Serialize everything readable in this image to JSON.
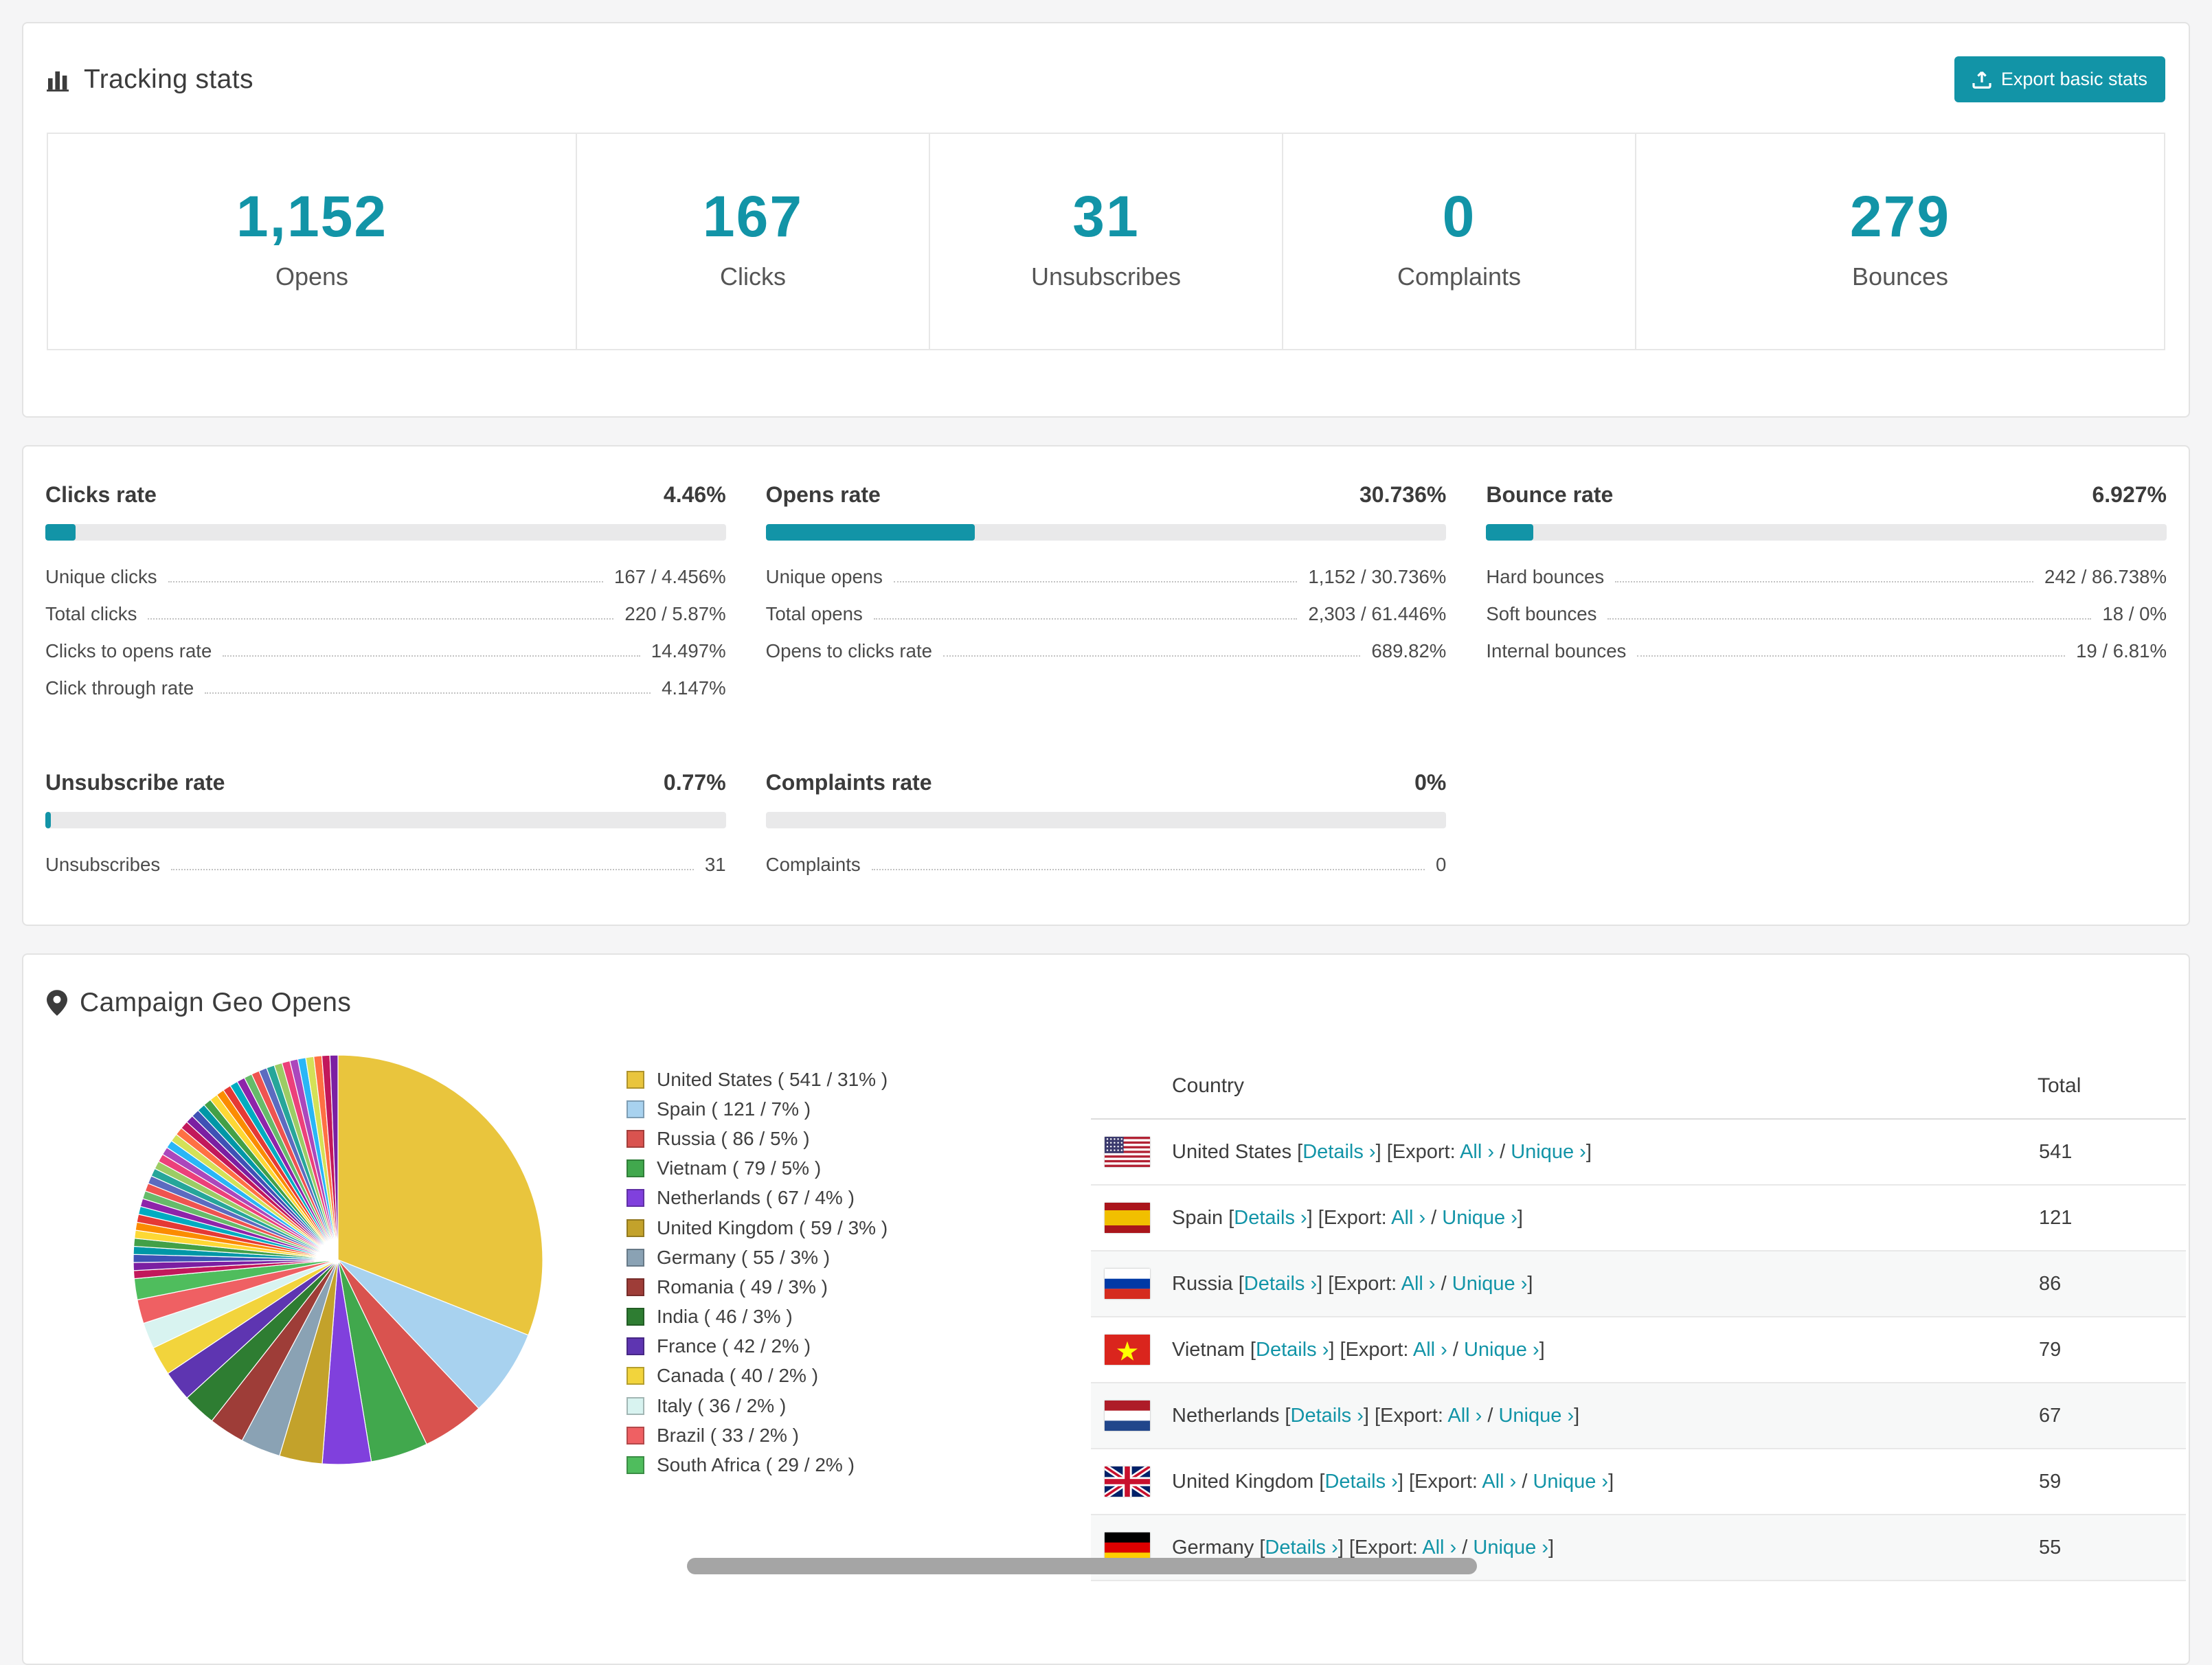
{
  "colors": {
    "accent": "#1294a7",
    "page_background": "#f5f5f6",
    "bar_track": "#e9e9ea"
  },
  "tracking": {
    "title": "Tracking stats",
    "export_button": "Export basic stats",
    "stats": [
      {
        "value": "1,152",
        "label": "Opens"
      },
      {
        "value": "167",
        "label": "Clicks"
      },
      {
        "value": "31",
        "label": "Unsubscribes"
      },
      {
        "value": "0",
        "label": "Complaints"
      },
      {
        "value": "279",
        "label": "Bounces"
      }
    ]
  },
  "rates": [
    {
      "title": "Clicks rate",
      "value": "4.46%",
      "percent_value": 4.46,
      "rows": [
        {
          "label": "Unique clicks",
          "value": "167 / 4.456%"
        },
        {
          "label": "Total clicks",
          "value": "220 / 5.87%"
        },
        {
          "label": "Clicks to opens rate",
          "value": "14.497%"
        },
        {
          "label": "Click through rate",
          "value": "4.147%"
        }
      ]
    },
    {
      "title": "Opens rate",
      "value": "30.736%",
      "percent_value": 30.736,
      "rows": [
        {
          "label": "Unique opens",
          "value": "1,152 / 30.736%"
        },
        {
          "label": "Total opens",
          "value": "2,303 / 61.446%"
        },
        {
          "label": "Opens to clicks rate",
          "value": "689.82%"
        }
      ]
    },
    {
      "title": "Bounce rate",
      "value": "6.927%",
      "percent_value": 6.927,
      "rows": [
        {
          "label": "Hard bounces",
          "value": "242 / 86.738%"
        },
        {
          "label": "Soft bounces",
          "value": "18 / 0%"
        },
        {
          "label": "Internal bounces",
          "value": "19 / 6.81%"
        }
      ]
    },
    {
      "title": "Unsubscribe rate",
      "value": "0.77%",
      "percent_value": 0.77,
      "rows": [
        {
          "label": "Unsubscribes",
          "value": "31"
        }
      ]
    },
    {
      "title": "Complaints rate",
      "value": "0%",
      "percent_value": 0,
      "rows": [
        {
          "label": "Complaints",
          "value": "0"
        }
      ]
    }
  ],
  "geo": {
    "title": "Campaign Geo Opens",
    "table": {
      "country_header": "Country",
      "total_header": "Total",
      "details_label": "Details",
      "export_label": "[Export:",
      "all_label": "All",
      "unique_label": "Unique",
      "rows": [
        {
          "country": "United States",
          "total": "541",
          "flag": "us"
        },
        {
          "country": "Spain",
          "total": "121",
          "flag": "es"
        },
        {
          "country": "Russia",
          "total": "86",
          "flag": "ru"
        },
        {
          "country": "Vietnam",
          "total": "79",
          "flag": "vn"
        },
        {
          "country": "Netherlands",
          "total": "67",
          "flag": "nl"
        },
        {
          "country": "United Kingdom",
          "total": "59",
          "flag": "gb"
        },
        {
          "country": "Germany",
          "total": "55",
          "flag": "de"
        }
      ]
    }
  },
  "chart_data": {
    "type": "pie",
    "title": "Campaign Geo Opens",
    "legend_position": "right",
    "slices": [
      {
        "label": "United States",
        "value": 541,
        "percent": 31,
        "color": "#e9c53d"
      },
      {
        "label": "Spain",
        "value": 121,
        "percent": 7,
        "color": "#a8d2ef"
      },
      {
        "label": "Russia",
        "value": 86,
        "percent": 5,
        "color": "#d9534f"
      },
      {
        "label": "Vietnam",
        "value": 79,
        "percent": 5,
        "color": "#41a84d"
      },
      {
        "label": "Netherlands",
        "value": 67,
        "percent": 4,
        "color": "#8040dd"
      },
      {
        "label": "United Kingdom",
        "value": 59,
        "percent": 3,
        "color": "#c3a22b"
      },
      {
        "label": "Germany",
        "value": 55,
        "percent": 3,
        "color": "#8aa2b4"
      },
      {
        "label": "Romania",
        "value": 49,
        "percent": 3,
        "color": "#9e3d38"
      },
      {
        "label": "India",
        "value": 46,
        "percent": 3,
        "color": "#2e7d32"
      },
      {
        "label": "France",
        "value": 42,
        "percent": 2,
        "color": "#5e35b1"
      },
      {
        "label": "Canada",
        "value": 40,
        "percent": 2,
        "color": "#f2d43c"
      },
      {
        "label": "Italy",
        "value": 36,
        "percent": 2,
        "color": "#d8f3f0"
      },
      {
        "label": "Brazil",
        "value": 33,
        "percent": 2,
        "color": "#ef6063"
      },
      {
        "label": "South Africa",
        "value": 29,
        "percent": 2,
        "color": "#4fbd5d"
      }
    ],
    "others": {
      "value": 462,
      "slice_count": 42,
      "colors": [
        "#c2185b",
        "#7b1fa2",
        "#3f51b5",
        "#0097a7",
        "#43a047",
        "#fdd835",
        "#fb8c00",
        "#e53935",
        "#00acc1",
        "#8e24aa",
        "#66bb6a",
        "#ef5350",
        "#5c6bc0",
        "#26a69a",
        "#9ccc65",
        "#ec407a",
        "#ab47bc",
        "#29b6f6",
        "#d4e157",
        "#ff7043"
      ]
    }
  }
}
